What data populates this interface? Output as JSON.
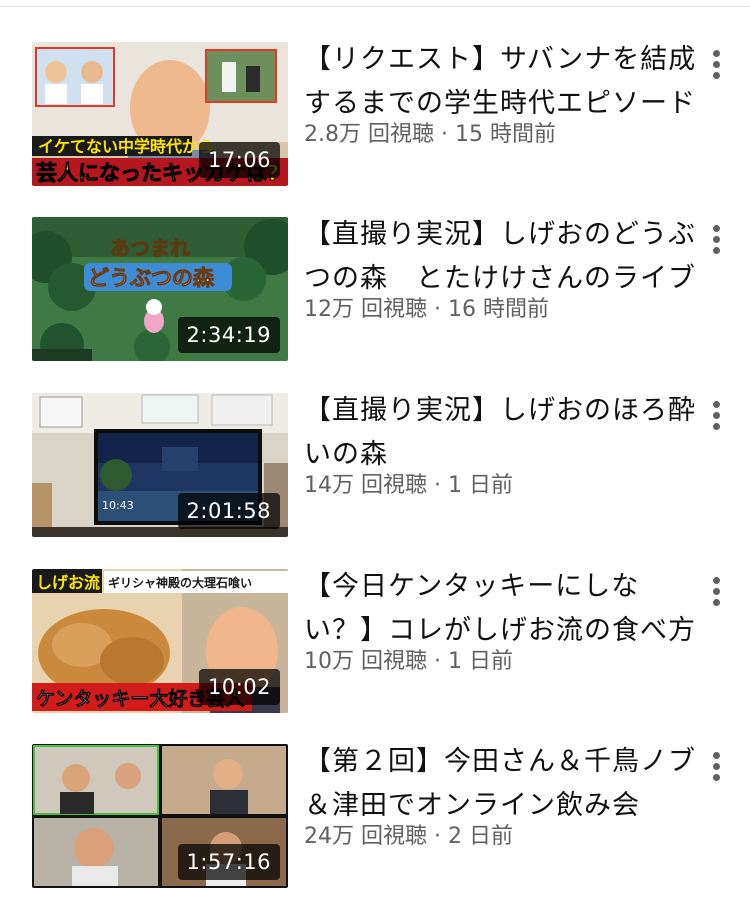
{
  "videos": [
    {
      "title": "【リクエスト】サバンナを結成するまでの学生時代エピソード",
      "duration": "17:06",
      "views": "2.8万 回視聴",
      "age": "15 時間前",
      "thumb_caption_1": "イケてない中学時代から",
      "thumb_caption_2": "芸人になったキッカケは?"
    },
    {
      "title": "【直撮り実況】しげおのどうぶつの森　とたけけさんのライブ",
      "duration": "2:34:19",
      "views": "12万 回視聴",
      "age": "16 時間前",
      "thumb_caption_1": "あつまれ",
      "thumb_caption_2": "どうぶつの森"
    },
    {
      "title": "【直撮り実況】しげおのほろ酔いの森",
      "duration": "2:01:58",
      "views": "14万 回視聴",
      "age": "1 日前",
      "thumb_caption_1": "10:43"
    },
    {
      "title": "【今日ケンタッキーにしない？】コレがしげお流の食べ方",
      "duration": "10:02",
      "views": "10万 回視聴",
      "age": "1 日前",
      "thumb_caption_1": "しげお流",
      "thumb_caption_2": "ギリシャ神殿の大理石喰い",
      "thumb_caption_3": "ケンタッキー大好き芸人"
    },
    {
      "title": "【第２回】今田さん＆千鳥ノブ＆津田でオンライン飲み会",
      "duration": "1:57:16",
      "views": "24万 回視聴",
      "age": "2 日前"
    }
  ],
  "meta_separator": " · ",
  "colors": {
    "title": "#111111",
    "meta": "#606060",
    "duration_bg": "rgba(0,0,0,0.72)"
  }
}
